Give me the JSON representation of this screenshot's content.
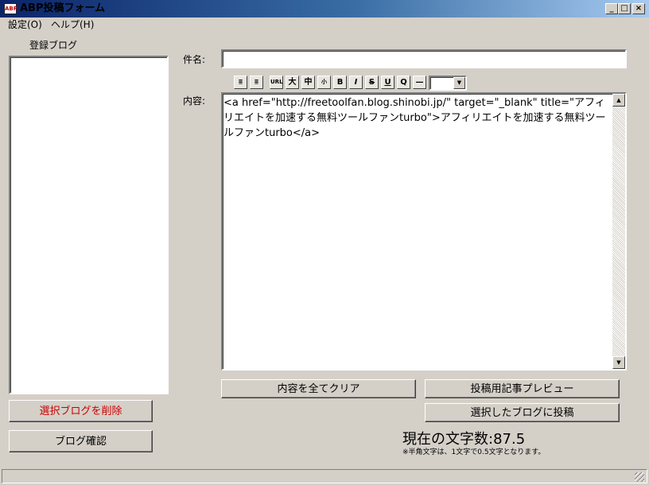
{
  "window": {
    "title": "ABP投稿フォーム",
    "icon_text": "ABP",
    "minimize_glyph": "_",
    "maximize_glyph": "□",
    "close_glyph": "×"
  },
  "menu": {
    "items": [
      "設定(O)",
      "ヘルプ(H)"
    ]
  },
  "sidebar": {
    "label": "登録ブログ",
    "delete_button": "選択ブログを削除",
    "delete_color": "#cc0000",
    "confirm_button": "ブログ確認"
  },
  "form": {
    "subject_label": "件名:",
    "subject_value": "",
    "content_label": "内容:",
    "content_value": "<a href=\"http://freetoolfan.blog.shinobi.jp/\" target=\"_blank\" title=\"アフィリエイトを加速する無料ツールファンturbo\">アフィリエイトを加速する無料ツールファンturbo</a>",
    "clear_button": "内容を全てクリア",
    "preview_button": "投稿用記事プレビュー",
    "post_button": "選択したブログに投稿"
  },
  "toolbar": {
    "buttons": [
      {
        "icon": "align-left-icon",
        "glyph": "≣"
      },
      {
        "icon": "align-right-icon",
        "glyph": "≣"
      },
      {
        "icon": "url-icon",
        "glyph": "URL"
      },
      {
        "icon": "font-large-icon",
        "glyph": "大"
      },
      {
        "icon": "font-medium-icon",
        "glyph": "中"
      },
      {
        "icon": "font-small-icon",
        "glyph": "小"
      },
      {
        "icon": "bold-icon",
        "glyph": "B"
      },
      {
        "icon": "italic-icon",
        "glyph": "I"
      },
      {
        "icon": "strike-icon",
        "glyph": "S"
      },
      {
        "icon": "underline-icon",
        "glyph": "U"
      },
      {
        "icon": "quote-icon",
        "glyph": "Q"
      },
      {
        "icon": "horizontal-rule-icon",
        "glyph": "—"
      }
    ],
    "color_select_value": "",
    "dropdown_glyph": "▼"
  },
  "status": {
    "char_count_label": "現在の文字数:87.5",
    "note": "※半角文字は、1文字で0.5文字となります。"
  },
  "scrollbar": {
    "up_glyph": "▲",
    "down_glyph": "▼"
  }
}
